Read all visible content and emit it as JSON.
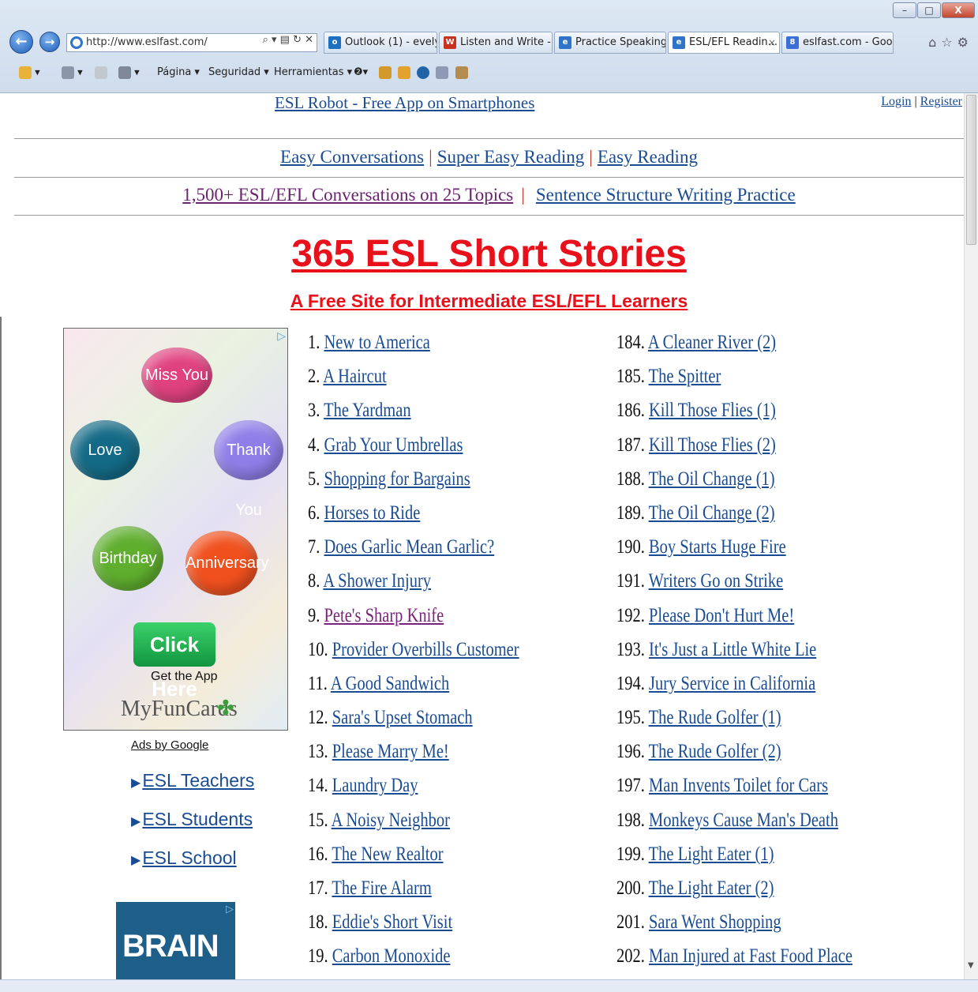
{
  "browser": {
    "url": "http://www.eslfast.com/",
    "address_tools": "⌕ ▾ ▤ ↻ ✕",
    "tabs": [
      {
        "label": "Outlook (1) - evely...",
        "icon_color": "#1f6fbf",
        "icon_text": "o",
        "active": false
      },
      {
        "label": "Listen and Write - ...",
        "icon_color": "#c8321e",
        "icon_text": "W",
        "active": false
      },
      {
        "label": "Practice Speaking ...",
        "icon_color": "#2f74c8",
        "icon_text": "e",
        "active": false
      },
      {
        "label": "ESL/EFL Readin...",
        "icon_color": "#2f74c8",
        "icon_text": "e",
        "active": true
      },
      {
        "label": "eslfast.com - Goo...",
        "icon_color": "#3a6fd8",
        "icon_text": "8",
        "active": false
      }
    ],
    "right_icons": "⌂☆⚙",
    "command_bar": {
      "page": "Página ▾",
      "security": "Seguridad ▾",
      "tools": "Herramientas ▾",
      "help": "❷▾"
    },
    "window_buttons": {
      "minimize": "–",
      "maximize": "□",
      "close": "X"
    }
  },
  "header": {
    "robot_link": "ESL Robot - Free App on Smartphones",
    "login": "Login",
    "auth_sep": " | ",
    "register": "Register"
  },
  "nav": {
    "row1": [
      "Easy Conversations",
      "Super Easy Reading",
      "Easy Reading"
    ],
    "row2": [
      "1,500+ ESL/EFL Conversations on 25 Topics",
      "Sentence Structure Writing Practice"
    ],
    "sep": "|"
  },
  "title": "365 ESL Short Stories",
  "subtitle": "A Free Site for Intermediate ESL/EFL Learners",
  "ad": {
    "bubbles": [
      "Miss You",
      "Love",
      "Thank You",
      "Birthday",
      "Anniversary"
    ],
    "click_here": "Click Here",
    "get_app": "Get the App",
    "brand": "MyFunCards",
    "ads_by": "Ads by Google",
    "links": [
      "ESL Teachers",
      "ESL Students",
      "ESL School"
    ],
    "ad2_text": "BRAIN",
    "corner": "▷",
    "colors": {
      "miss_you": "#e0427f",
      "love": "#146a86",
      "thank_you": "#8f7ee8",
      "birthday": "#5fae2e",
      "anniversary": "#f0501e"
    }
  },
  "stories_left": [
    {
      "n": "1.",
      "t": "New to America"
    },
    {
      "n": "2.",
      "t": "A Haircut"
    },
    {
      "n": "3.",
      "t": "The Yardman"
    },
    {
      "n": "4.",
      "t": "Grab Your Umbrellas"
    },
    {
      "n": "5.",
      "t": "Shopping for Bargains"
    },
    {
      "n": "6.",
      "t": "Horses to Ride"
    },
    {
      "n": "7.",
      "t": "Does Garlic Mean Garlic?"
    },
    {
      "n": "8.",
      "t": "A Shower Injury"
    },
    {
      "n": "9.",
      "t": "Pete's Sharp Knife",
      "visited": true
    },
    {
      "n": "10.",
      "t": "Provider Overbills Customer"
    },
    {
      "n": "11.",
      "t": "A Good Sandwich"
    },
    {
      "n": "12.",
      "t": "Sara's Upset Stomach"
    },
    {
      "n": "13.",
      "t": "Please Marry Me!"
    },
    {
      "n": "14.",
      "t": "Laundry Day"
    },
    {
      "n": "15.",
      "t": "A Noisy Neighbor"
    },
    {
      "n": "16.",
      "t": "The New Realtor"
    },
    {
      "n": "17.",
      "t": "The Fire Alarm"
    },
    {
      "n": "18.",
      "t": "Eddie's Short Visit"
    },
    {
      "n": "19.",
      "t": "Carbon Monoxide"
    }
  ],
  "stories_right": [
    {
      "n": "184.",
      "t": "A Cleaner River (2)"
    },
    {
      "n": "185.",
      "t": "The Spitter"
    },
    {
      "n": "186.",
      "t": "Kill Those Flies (1)"
    },
    {
      "n": "187.",
      "t": "Kill Those Flies (2)"
    },
    {
      "n": "188.",
      "t": "The Oil Change (1)"
    },
    {
      "n": "189.",
      "t": "The Oil Change (2)"
    },
    {
      "n": "190.",
      "t": "Boy Starts Huge Fire"
    },
    {
      "n": "191.",
      "t": "Writers Go on Strike"
    },
    {
      "n": "192.",
      "t": "Please Don't Hurt Me!"
    },
    {
      "n": "193.",
      "t": "It's Just a Little White Lie"
    },
    {
      "n": "194.",
      "t": "Jury Service in California"
    },
    {
      "n": "195.",
      "t": "The Rude Golfer (1)"
    },
    {
      "n": "196.",
      "t": "The Rude Golfer (2)"
    },
    {
      "n": "197.",
      "t": "Man Invents Toilet for Cars"
    },
    {
      "n": "198.",
      "t": "Monkeys Cause Man's Death"
    },
    {
      "n": "199.",
      "t": "The Light Eater (1)"
    },
    {
      "n": "200.",
      "t": "The Light Eater (2)"
    },
    {
      "n": "201.",
      "t": "Sara Went Shopping"
    },
    {
      "n": "202.",
      "t": "Man Injured at Fast Food Place"
    }
  ]
}
